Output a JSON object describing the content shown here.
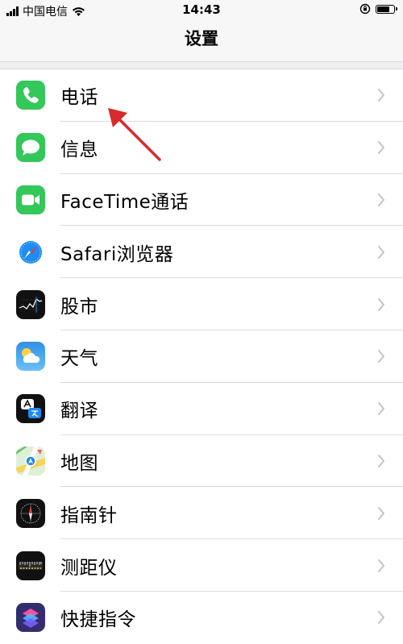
{
  "status_bar": {
    "carrier": "中国电信",
    "time": "14:43"
  },
  "nav": {
    "title": "设置"
  },
  "settings": {
    "items": [
      {
        "label": "电话",
        "icon": "phone-icon"
      },
      {
        "label": "信息",
        "icon": "messages-icon"
      },
      {
        "label": "FaceTime通话",
        "icon": "facetime-icon"
      },
      {
        "label": "Safari浏览器",
        "icon": "safari-icon"
      },
      {
        "label": "股市",
        "icon": "stocks-icon"
      },
      {
        "label": "天气",
        "icon": "weather-icon"
      },
      {
        "label": "翻译",
        "icon": "translate-icon"
      },
      {
        "label": "地图",
        "icon": "maps-icon"
      },
      {
        "label": "指南针",
        "icon": "compass-icon"
      },
      {
        "label": "测距仪",
        "icon": "measure-icon"
      },
      {
        "label": "快捷指令",
        "icon": "shortcuts-icon"
      }
    ]
  },
  "colors": {
    "accent_arrow": "#d92b2b",
    "chevron": "#c4c4c7"
  }
}
